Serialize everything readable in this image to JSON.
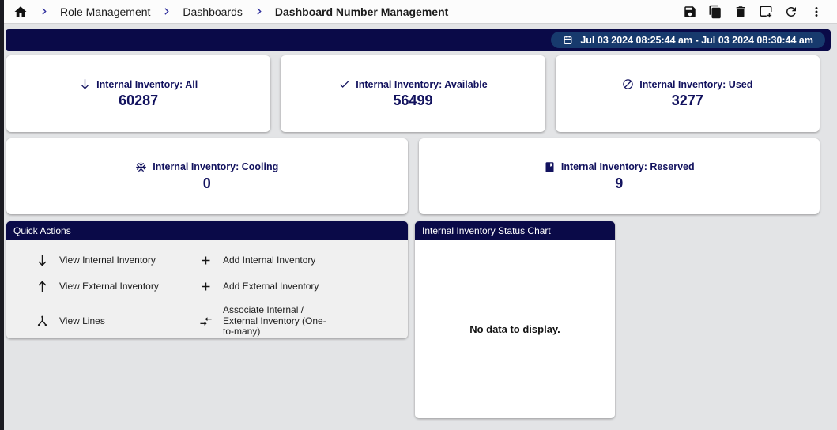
{
  "colors": {
    "navy_bar": "#0a0a48",
    "date_pill_blue": "#173a6d",
    "card_text_navy": "#12125e",
    "breadcrumb_chevron": "#2f2f9d",
    "page_background": "#e3e4e6",
    "quick_actions_body": "#f0f0f0"
  },
  "topbar": {
    "breadcrumbs": [
      {
        "label": "Role Management"
      },
      {
        "label": "Dashboards"
      },
      {
        "label": "Dashboard Number Management"
      }
    ],
    "toolbar_icons": [
      "save-icon",
      "copy-icon",
      "delete-icon",
      "new-window-add-icon",
      "refresh-icon",
      "more-vert-icon"
    ]
  },
  "date_bar": {
    "icon": "calendar-icon",
    "range_label": "Jul 03 2024 08:25:44 am - Jul 03 2024 08:30:44 am"
  },
  "stat_cards": [
    {
      "icon": "arrow-down-icon",
      "title": "Internal Inventory: All",
      "value": "60287"
    },
    {
      "icon": "check-icon",
      "title": "Internal Inventory: Available",
      "value": "56499"
    },
    {
      "icon": "block-icon",
      "title": "Internal Inventory: Used",
      "value": "3277"
    },
    {
      "icon": "snowflake-icon",
      "title": "Internal Inventory: Cooling",
      "value": "0"
    },
    {
      "icon": "book-icon",
      "title": "Internal Inventory: Reserved",
      "value": "9"
    }
  ],
  "quick_actions": {
    "title": "Quick Actions",
    "left_items": [
      {
        "icon": "arrow-down-icon",
        "label": "View Internal Inventory"
      },
      {
        "icon": "arrow-up-icon",
        "label": "View External Inventory"
      },
      {
        "icon": "split-icon",
        "label": "View Lines"
      }
    ],
    "right_items": [
      {
        "icon": "plus-icon",
        "label": "Add Internal Inventory"
      },
      {
        "icon": "plus-icon",
        "label": "Add External Inventory"
      },
      {
        "icon": "merge-arrows-icon",
        "label": "Associate Internal / External Inventory (One-to-many)"
      }
    ]
  },
  "chart_panel": {
    "title": "Internal Inventory Status Chart",
    "empty_message": "No data to display."
  }
}
